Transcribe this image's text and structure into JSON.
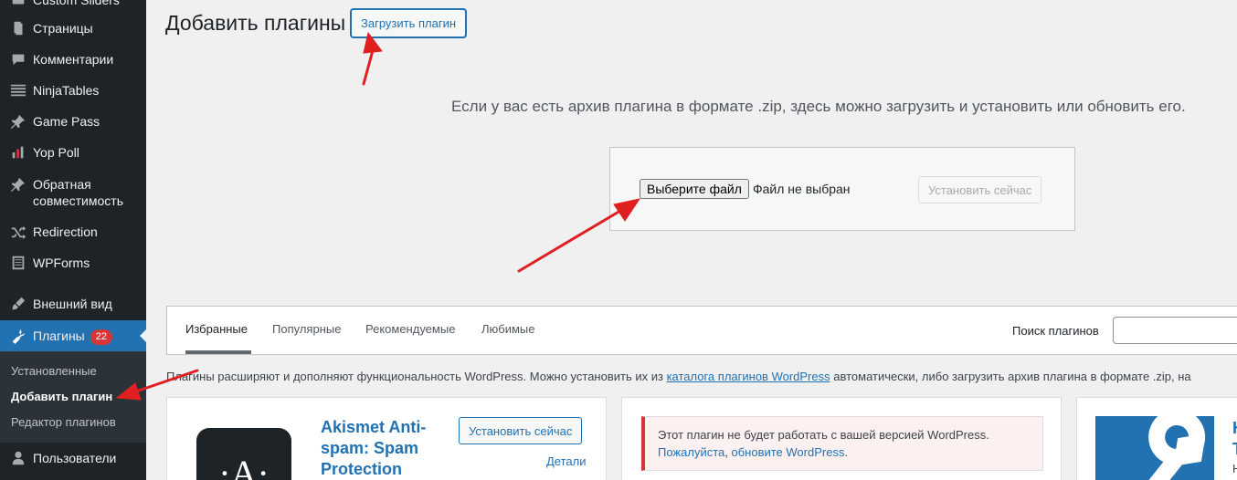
{
  "sidebar": {
    "items": [
      {
        "label": "Custom Sliders",
        "icon": "sliders-icon"
      },
      {
        "label": "Страницы",
        "icon": "pages-icon"
      },
      {
        "label": "Комментарии",
        "icon": "comments-icon"
      },
      {
        "label": "NinjaTables",
        "icon": "table-icon"
      },
      {
        "label": "Game Pass",
        "icon": "pin-icon"
      },
      {
        "label": "Yop Poll",
        "icon": "bar-chart-icon"
      },
      {
        "label": "Обратная совместимость",
        "icon": "pin-icon"
      },
      {
        "label": "Redirection",
        "icon": "shuffle-icon"
      },
      {
        "label": "WPForms",
        "icon": "form-icon"
      },
      {
        "label": "Внешний вид",
        "icon": "brush-icon"
      },
      {
        "label": "Плагины",
        "icon": "plugin-icon",
        "badge": "22"
      },
      {
        "label": "Пользователи",
        "icon": "user-icon"
      }
    ],
    "submenu": [
      "Установленные",
      "Добавить плагин",
      "Редактор плагинов"
    ]
  },
  "header": {
    "title": "Добавить плагины",
    "upload_button": "Загрузить плагин"
  },
  "upload": {
    "help": "Если у вас есть архив плагина в формате .zip, здесь можно загрузить и установить или обновить его.",
    "choose_file": "Выберите файл",
    "file_status": "Файл не выбран",
    "install_now": "Установить сейчас"
  },
  "tabs": {
    "items": [
      "Избранные",
      "Популярные",
      "Рекомендуемые",
      "Любимые"
    ],
    "search_label": "Поиск плагинов"
  },
  "intro": {
    "before": "Плагины расширяют и дополняют функциональность WordPress. Можно установить их из ",
    "link": "каталога плагинов WordPress",
    "after": " автоматически, либо загрузить архив плагина в формате .zip, на"
  },
  "cards": {
    "akismet": {
      "title": "Akismet Anti-spam: Spam Protection",
      "install": "Установить сейчас",
      "details": "Детали"
    },
    "notice": {
      "text": "Этот плагин не будет работать с вашей версией WordPress.",
      "link1": "Пожалуйста",
      "sep": ", ",
      "link2": "обновите WordPress",
      "end": "."
    },
    "third": {
      "title_fragment1": "H",
      "title_fragment2": "T",
      "text_fragment": "H"
    }
  },
  "colors": {
    "sidebar_bg": "#1d2327",
    "accent": "#2271b1",
    "badge": "#d63638",
    "annotation_arrow": "#e02020"
  }
}
